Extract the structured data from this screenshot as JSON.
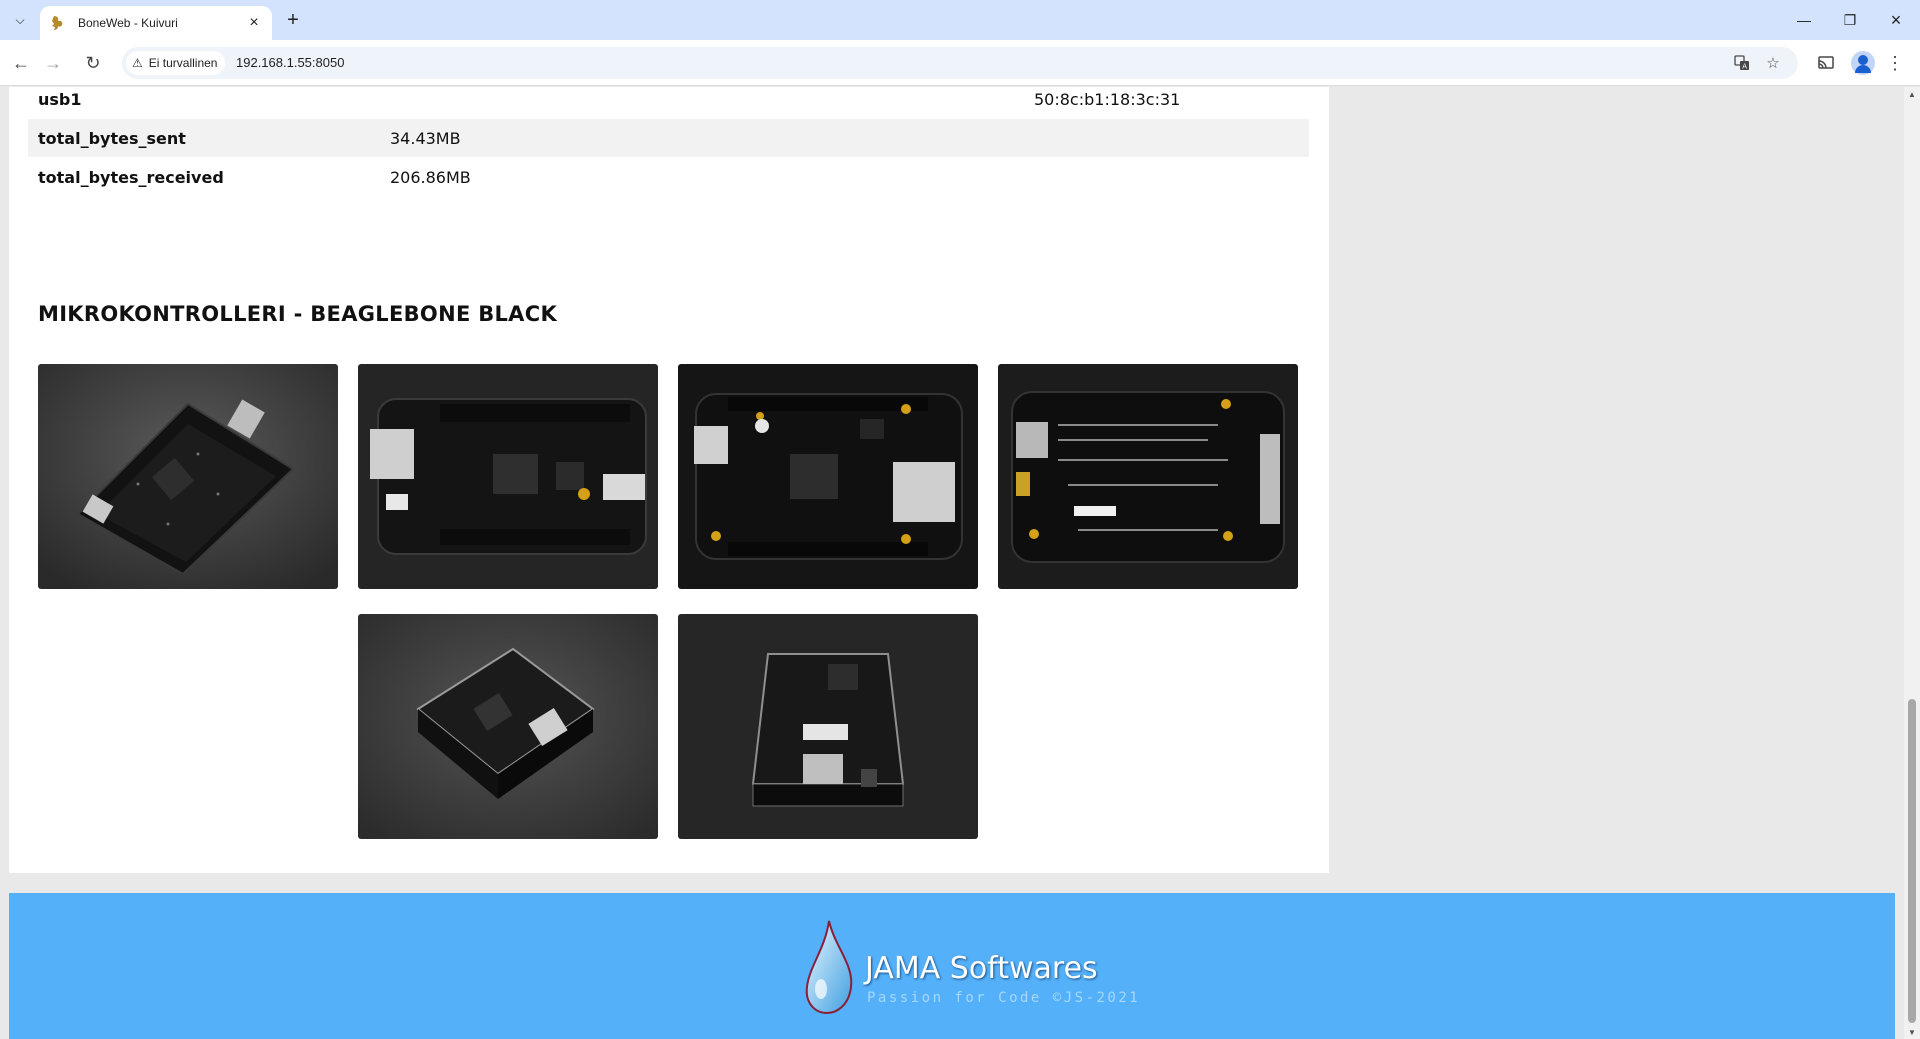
{
  "browser": {
    "tab_title": "BoneWeb - Kuivuri",
    "security_label": "Ei turvallinen",
    "url": "192.168.1.55:8050",
    "icons": [
      "tab-list-icon",
      "favicon-icon",
      "close-icon",
      "new-tab-icon",
      "minimize-icon",
      "restore-icon",
      "window-close-icon",
      "back-icon",
      "forward-icon",
      "reload-icon",
      "warning-icon",
      "translate-icon",
      "bookmark-star-icon",
      "cast-icon",
      "profile-icon",
      "menu-icon"
    ]
  },
  "network": {
    "rows": [
      {
        "key": "usb1",
        "value": "",
        "value2": "50:8c:b1:18:3c:31"
      },
      {
        "key": "total_bytes_sent",
        "value": "34.43MB",
        "value2": ""
      },
      {
        "key": "total_bytes_received",
        "value": "206.86MB",
        "value2": ""
      }
    ]
  },
  "gallery": {
    "title": "MIKROKONTROLLERI - BEAGLEBONE BLACK",
    "photos": [
      "BeagleBone Black board angled view",
      "BeagleBone Black board side view",
      "BeagleBone Black board top view",
      "BeagleBone Black board bottom view",
      "BeagleBone Black in clear case angled",
      "BeagleBone Black in clear case front"
    ]
  },
  "footer": {
    "brand": "JAMA Softwares",
    "tagline": "Passion for Code ©JS-2021",
    "colors": {
      "footer_bg": "#54b0f9"
    }
  }
}
